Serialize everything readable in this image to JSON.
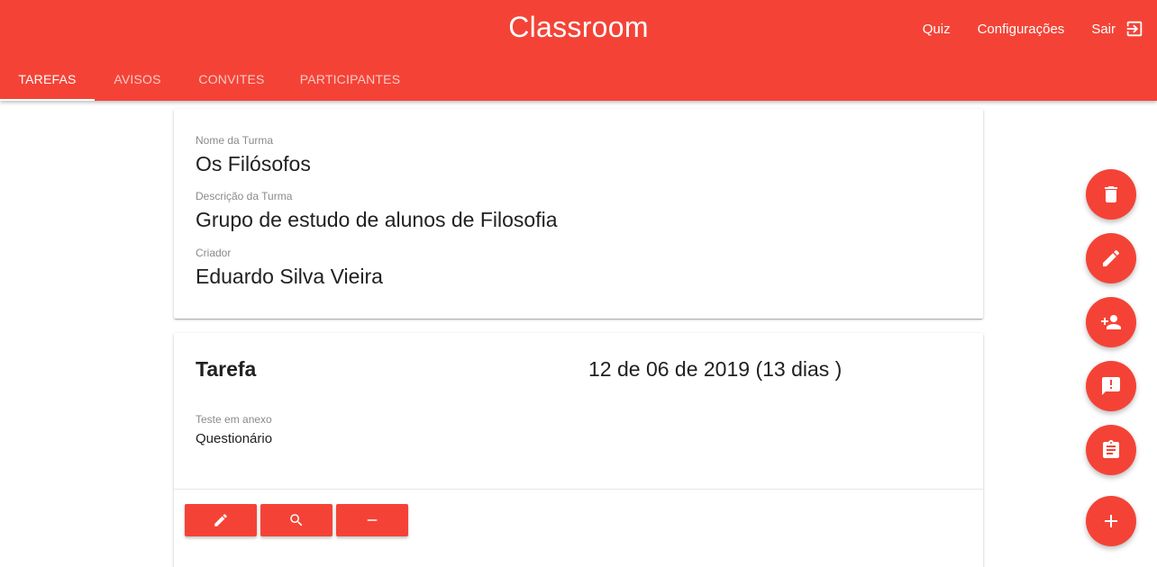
{
  "header": {
    "title": "Classroom",
    "links": {
      "quiz": "Quiz",
      "settings": "Configurações",
      "logout": "Sair"
    }
  },
  "tabs": [
    {
      "label": "TAREFAS",
      "active": true
    },
    {
      "label": "AVISOS",
      "active": false
    },
    {
      "label": "CONVITES",
      "active": false
    },
    {
      "label": "PARTICIPANTES",
      "active": false
    }
  ],
  "class_info": {
    "name_label": "Nome da Turma",
    "name": "Os Filósofos",
    "description_label": "Descrição da Turma",
    "description": "Grupo de estudo de alunos de Filosofia",
    "creator_label": "Criador",
    "creator": "Eduardo Silva Vieira"
  },
  "task": {
    "title": "Tarefa",
    "date": "12 de 06 de 2019 (13 dias )",
    "attachment_label": "Teste em anexo",
    "attachment": "Questionário",
    "buttons": [
      "edit-icon",
      "search-icon",
      "remove-icon"
    ]
  },
  "fabs": [
    "delete-icon",
    "edit-icon",
    "person-add-icon",
    "announcement-icon",
    "assignment-icon",
    "add-icon"
  ],
  "colors": {
    "primary": "#f44336",
    "on_primary": "#ffffff"
  }
}
